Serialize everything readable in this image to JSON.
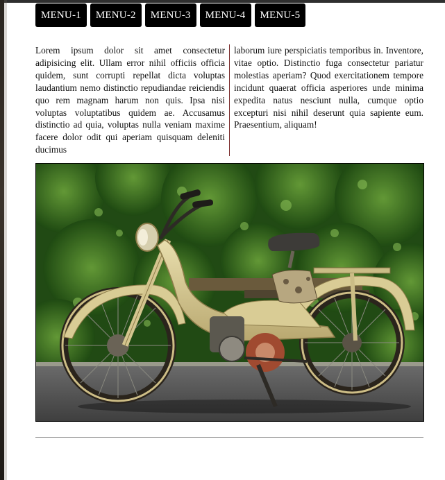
{
  "nav": {
    "items": [
      {
        "label": "MENU-1"
      },
      {
        "label": "MENU-2"
      },
      {
        "label": "MENU-3"
      },
      {
        "label": "MENU-4"
      },
      {
        "label": "MENU-5"
      }
    ]
  },
  "article": {
    "left_text": "Lorem ipsum dolor sit amet consectetur adipisicing elit. Ullam error nihil officiis officia quidem, sunt corrupti repellat dicta voluptas laudantium nemo distinctio repudiandae reiciendis quo rem magnam harum non quis. Ipsa nisi voluptas voluptatibus quidem ae. Accusamus distinctio ad quia, voluptas nulla veniam maxime facere dolor odit qui aperiam quisquam deleniti ducimus",
    "right_text": "laborum iure perspiciatis temporibus in. Inventore, vitae optio. Distinctio fuga consectetur pariatur molestias aperiam? Quod exercitationem tempore incidunt quaerat officia asperiores unde minima expedita natus nesciunt nulla, cumque optio excepturi nisi nihil deserunt quia sapiente eum. Praesentium, aliquam!"
  },
  "photo": {
    "subject": "vintage-moped-image",
    "colors": {
      "foliage": "#2f6b1f",
      "frame": "#d9cc95",
      "road": "#5a5a5a"
    }
  }
}
